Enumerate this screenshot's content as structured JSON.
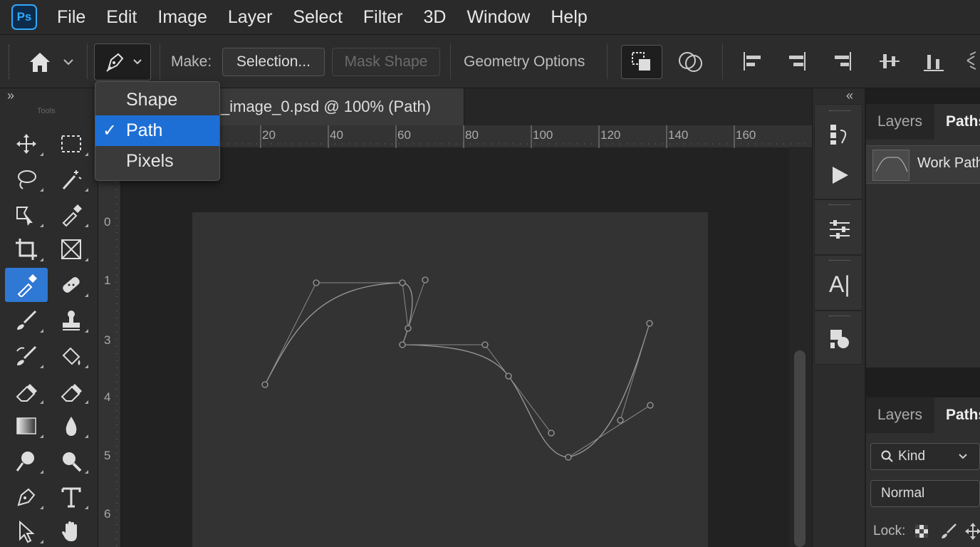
{
  "app": {
    "logo_text": "Ps",
    "brand_color": "#31a8ff",
    "accent_color": "#1d6fd6"
  },
  "menu": [
    "File",
    "Edit",
    "Image",
    "Layer",
    "Select",
    "Filter",
    "3D",
    "Window",
    "Help"
  ],
  "options_bar": {
    "make_label": "Make:",
    "selection_button": "Selection...",
    "mask_button": "Mask Shape",
    "geometry_label": "Geometry Options"
  },
  "tool_mode_dropdown": {
    "items": [
      "Shape",
      "Path",
      "Pixels"
    ],
    "selected": "Path",
    "check_mark": "✓"
  },
  "toolbar": {
    "collapse_glyph": "»",
    "title": "Tools"
  },
  "document": {
    "tab_title": "_image_0.psd @ 100% (Path)",
    "ruler_h": [
      "20",
      "40",
      "60",
      "80",
      "100",
      "120",
      "140",
      "160"
    ],
    "ruler_v": [
      "0",
      "1",
      "3",
      "4",
      "5",
      "6"
    ]
  },
  "right_panels": {
    "collapse_glyph": "«",
    "top_tabs": [
      "Layers",
      "Paths"
    ],
    "work_path_label": "Work Path",
    "bottom_tabs": [
      "Layers",
      "Paths"
    ],
    "kind_label": "Kind",
    "blend_mode": "Normal",
    "lock_label": "Lock:"
  }
}
